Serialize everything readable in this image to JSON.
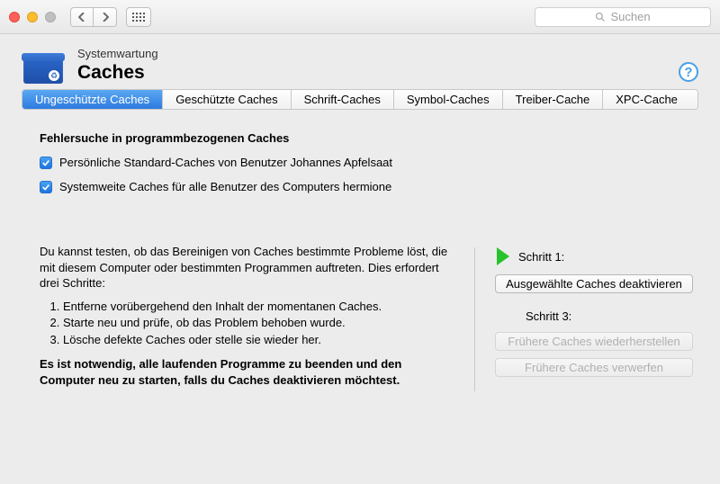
{
  "toolbar": {
    "search_placeholder": "Suchen"
  },
  "header": {
    "subtitle": "Systemwartung",
    "title": "Caches",
    "help": "?"
  },
  "tabs": {
    "t0": "Ungeschützte Caches",
    "t1": "Geschützte Caches",
    "t2": "Schrift-Caches",
    "t3": "Symbol-Caches",
    "t4": "Treiber-Cache",
    "t5": "XPC-Cache"
  },
  "section": {
    "title": "Fehlersuche in programmbezogenen Caches",
    "check1": "Persönliche Standard-Caches von Benutzer Johannes Apfelsaat",
    "check2": "Systemweite Caches für alle Benutzer des Computers hermione"
  },
  "info": {
    "intro": "Du kannst testen, ob das Bereinigen von Caches bestimmte Probleme löst, die mit diesem Computer oder bestimmten Programmen auftreten. Dies erfordert drei Schritte:",
    "li1": "Entferne vorübergehend den Inhalt der momentanen Caches.",
    "li2": "Starte neu und prüfe, ob das Problem behoben wurde.",
    "li3": "Lösche defekte Caches oder stelle sie wieder her.",
    "warn": "Es ist notwendig, alle laufenden Programme zu beenden und den Computer neu zu starten, falls du Caches deaktivieren möchtest."
  },
  "steps": {
    "s1": "Schritt 1:",
    "b1": "Ausgewählte Caches deaktivieren",
    "s3": "Schritt 3:",
    "b2": "Frühere Caches wiederherstellen",
    "b3": "Frühere Caches verwerfen"
  }
}
